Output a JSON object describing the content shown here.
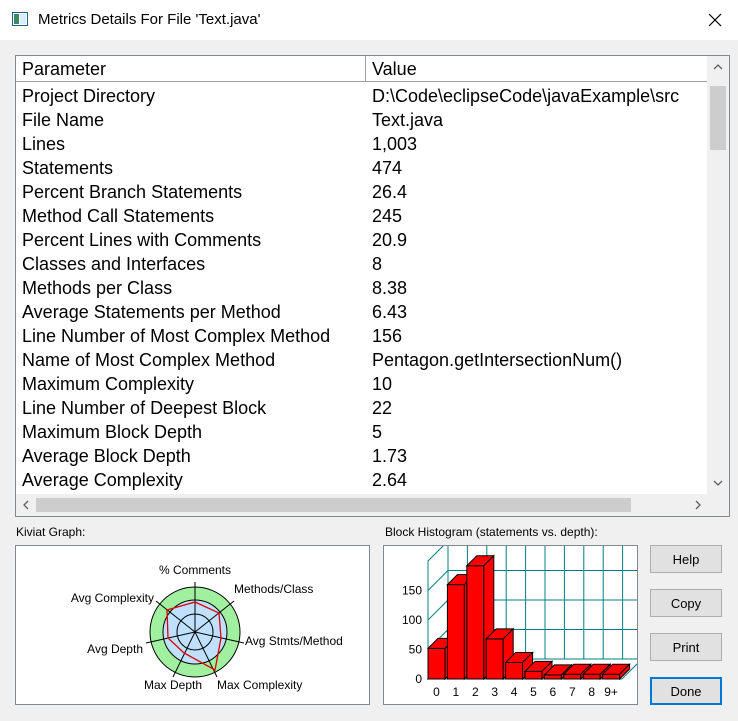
{
  "window": {
    "title": "Metrics Details For File 'Text.java'"
  },
  "table": {
    "columns": [
      "Parameter",
      "Value"
    ],
    "rows": [
      {
        "param": "Project Directory",
        "value": "D:\\Code\\eclipseCode\\javaExample\\src"
      },
      {
        "param": "File Name",
        "value": "Text.java"
      },
      {
        "param": "Lines",
        "value": "1,003"
      },
      {
        "param": "Statements",
        "value": "474"
      },
      {
        "param": "Percent Branch Statements",
        "value": "26.4"
      },
      {
        "param": "Method Call Statements",
        "value": "245"
      },
      {
        "param": "Percent Lines with Comments",
        "value": "20.9"
      },
      {
        "param": "Classes and Interfaces",
        "value": "8"
      },
      {
        "param": "Methods per Class",
        "value": "8.38"
      },
      {
        "param": "Average Statements per Method",
        "value": "6.43"
      },
      {
        "param": "Line Number of Most Complex Method",
        "value": "156"
      },
      {
        "param": "Name of Most Complex Method",
        "value": "Pentagon.getIntersectionNum()"
      },
      {
        "param": "Maximum Complexity",
        "value": "10"
      },
      {
        "param": "Line Number of Deepest Block",
        "value": "22"
      },
      {
        "param": "Maximum Block Depth",
        "value": "5"
      },
      {
        "param": "Average Block Depth",
        "value": "1.73"
      },
      {
        "param": "Average Complexity",
        "value": "2.64"
      }
    ]
  },
  "kiviat": {
    "label": "Kiviat Graph:",
    "axes": [
      "% Comments",
      "Methods/Class",
      "Avg Stmts/Method",
      "Max Complexity",
      "Max Depth",
      "Avg Depth",
      "Avg Complexity"
    ],
    "colors": {
      "outer_ring": "#a0f0a0",
      "inner_zone": "#bfe0ff",
      "profile": "#e00000"
    }
  },
  "histogram": {
    "label": "Block Histogram (statements vs. depth):",
    "bar_color": "#ff0000",
    "grid_color": "#008080"
  },
  "chart_data": {
    "type": "bar",
    "categories": [
      "0",
      "1",
      "2",
      "3",
      "4",
      "5",
      "6",
      "7",
      "8",
      "9+"
    ],
    "values": [
      52,
      160,
      192,
      68,
      28,
      13,
      7,
      8,
      8,
      8
    ],
    "y_ticks": [
      "0",
      "50",
      "100",
      "150"
    ],
    "ylim": [
      0,
      200
    ],
    "xlabel": "",
    "ylabel": "",
    "title": ""
  },
  "buttons": {
    "help": "Help",
    "copy": "Copy",
    "print": "Print",
    "done": "Done"
  }
}
